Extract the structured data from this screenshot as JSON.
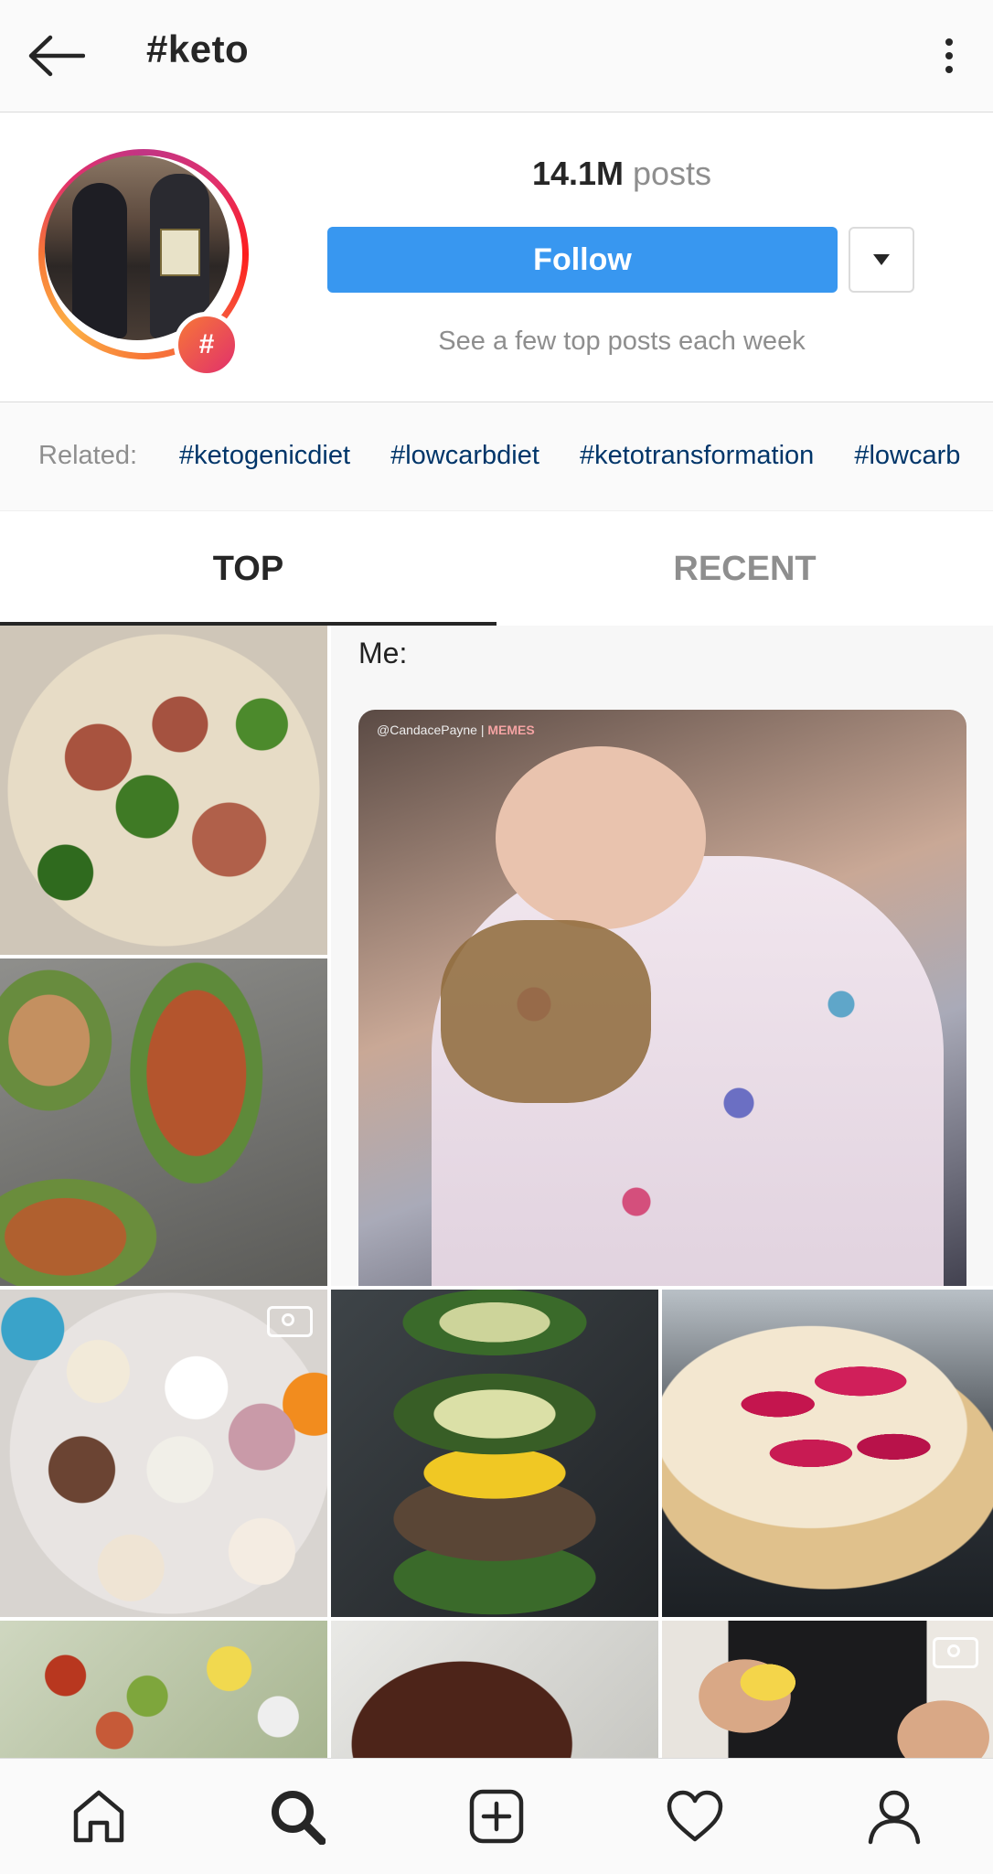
{
  "topbar": {
    "back_icon": "arrow-left-icon",
    "title": "#keto",
    "more_icon": "more-vertical-icon"
  },
  "header": {
    "badge_symbol": "#",
    "posts_count": "14.1M",
    "posts_label": "posts",
    "follow_label": "Follow",
    "dropdown_icon": "caret-down-icon",
    "tagline": "See a few top posts each week",
    "ring_colors": [
      "#c13584",
      "#e1306c",
      "#f77737",
      "#fcaf45"
    ],
    "follow_color": "#3897f0"
  },
  "related": {
    "label": "Related:",
    "tags": [
      "#ketogenicdiet",
      "#lowcarbdiet",
      "#ketotransformation",
      "#lowcarb"
    ]
  },
  "tabs": [
    {
      "label": "TOP",
      "active": true
    },
    {
      "label": "RECENT",
      "active": false
    }
  ],
  "grid": {
    "meme_caption": "Me:",
    "meme_watermark_user": "@CandacePayne",
    "meme_watermark_brand": "MEMES",
    "tiles": [
      {
        "subject": "sausage broccoli cauliflower rice"
      },
      {
        "subject": "spinach stuffed chicken breast"
      },
      {
        "subject": "baby meme video"
      },
      {
        "subject": "rebel ice cream cups",
        "video": true
      },
      {
        "subject": "zucchini burger stack"
      },
      {
        "subject": "raspberry swirl cheesecake"
      },
      {
        "subject": "cobb salad"
      },
      {
        "subject": "steak with herb butter"
      },
      {
        "subject": "chef squeezing lemon",
        "video": true
      }
    ]
  },
  "bottomnav": {
    "items": [
      "home-icon",
      "search-icon",
      "new-post-icon",
      "activity-heart-icon",
      "profile-icon"
    ]
  }
}
